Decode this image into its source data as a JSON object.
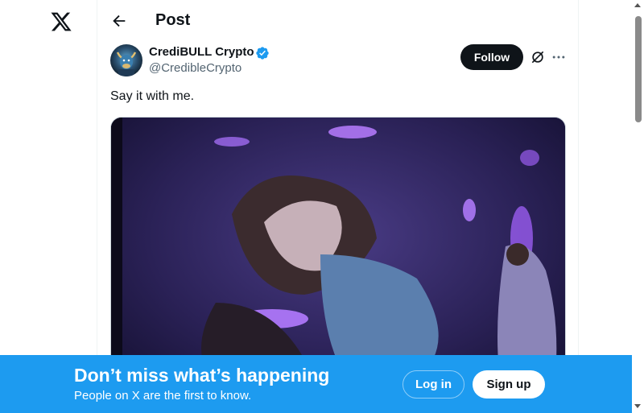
{
  "header": {
    "title": "Post"
  },
  "post": {
    "author_name": "CrediBULL Crypto",
    "author_handle": "@CredibleCrypto",
    "follow_label": "Follow",
    "text": "Say it with me."
  },
  "banner": {
    "title": "Don’t miss what’s happening",
    "subtitle": "People on X are the first to know.",
    "login_label": "Log in",
    "signup_label": "Sign up"
  },
  "colors": {
    "accent": "#1d9bf0",
    "text": "#0f1419",
    "muted": "#536471",
    "verified": "#1d9bf0"
  }
}
